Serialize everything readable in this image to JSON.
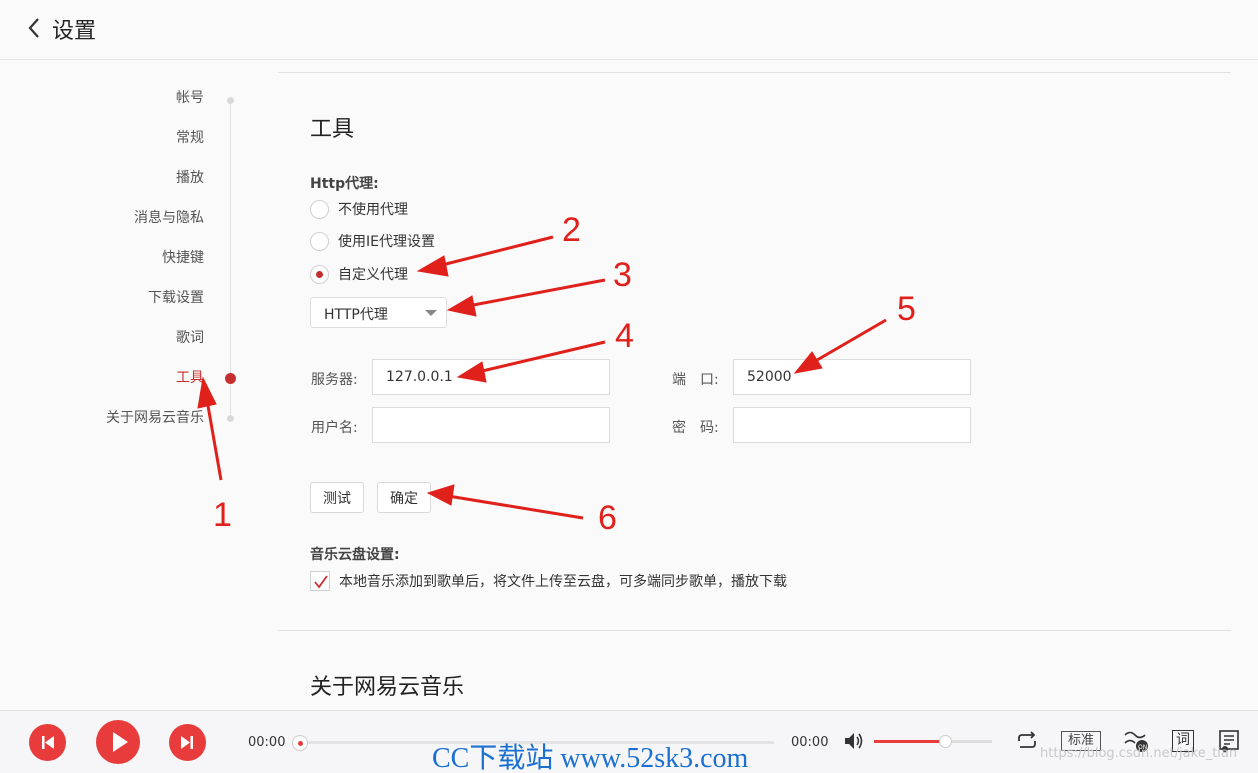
{
  "header": {
    "title": "设置"
  },
  "sidebar": {
    "items": [
      {
        "label": "帐号"
      },
      {
        "label": "常规"
      },
      {
        "label": "播放"
      },
      {
        "label": "消息与隐私"
      },
      {
        "label": "快捷键"
      },
      {
        "label": "下载设置"
      },
      {
        "label": "歌词"
      },
      {
        "label": "工具"
      },
      {
        "label": "关于网易云音乐"
      }
    ],
    "active": "工具"
  },
  "tools": {
    "title": "工具",
    "http_proxy_label": "Http代理:",
    "proxy_options": [
      "不使用代理",
      "使用IE代理设置",
      "自定义代理"
    ],
    "proxy_selected": "自定义代理",
    "proxy_type": "HTTP代理",
    "server_label": "服务器:",
    "server_value": "127.0.0.1",
    "port_label": "端　口:",
    "port_value": "52000",
    "username_label": "用户名:",
    "username_value": "",
    "password_label": "密　码:",
    "password_value": "",
    "test_button": "测试",
    "confirm_button": "确定",
    "cloud_label": "音乐云盘设置:",
    "cloud_checkbox": "本地音乐添加到歌单后，将文件上传至云盘，可多端同步歌单，播放下载",
    "cloud_checked": true
  },
  "about": {
    "title": "关于网易云音乐"
  },
  "annotations": [
    "1",
    "2",
    "3",
    "4",
    "5",
    "6"
  ],
  "player": {
    "current_time": "00:00",
    "total_time": "00:00",
    "volume_fraction": 0.6,
    "quality_label": "标准",
    "lyrics_label": "词"
  },
  "watermark": "CC下载站 www.52sk3.com",
  "watermark_url": "https://blog.csdn.net/jake_tian",
  "colors": {
    "accent": "#c62f2f",
    "annotation": "#e0201b",
    "player_red": "#e83c3c"
  }
}
